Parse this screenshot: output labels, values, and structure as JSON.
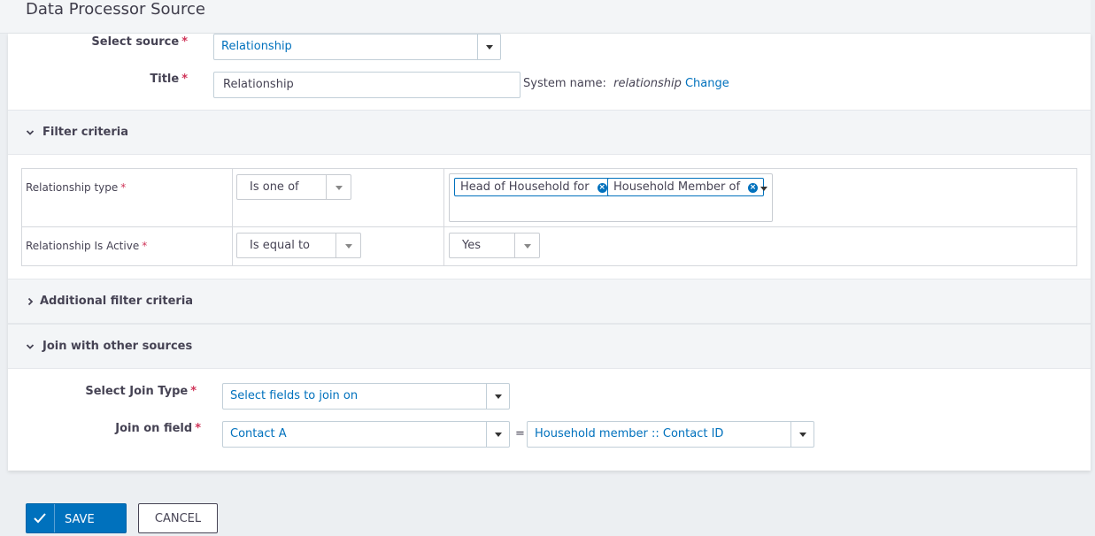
{
  "page": {
    "title": "Data Processor Source"
  },
  "source": {
    "select_label": "Select source",
    "select_value": "Relationship",
    "title_label": "Title",
    "title_value": "Relationship",
    "system_name_label": "System name:",
    "system_name_value": "relationship",
    "change_link": "Change",
    "required_mark": "*"
  },
  "filter_section": {
    "label": "Filter criteria",
    "rows": [
      {
        "field": "Relationship type",
        "operator": "Is one of",
        "tags": [
          "Head of Household for",
          "Household Member of"
        ]
      },
      {
        "field": "Relationship Is Active",
        "operator": "Is equal to",
        "value": "Yes"
      }
    ]
  },
  "additional_section": {
    "label": "Additional filter criteria"
  },
  "join_section": {
    "label": "Join with other sources",
    "join_type_label": "Select Join Type",
    "join_type_value": "Select fields to join on",
    "join_field_label": "Join on field",
    "join_field_left": "Contact A",
    "equals": "=",
    "join_field_right": "Household member :: Contact ID"
  },
  "buttons": {
    "save": "SAVE",
    "cancel": "CANCEL"
  },
  "colors": {
    "accent": "#0071bd",
    "required": "#cf3458"
  }
}
